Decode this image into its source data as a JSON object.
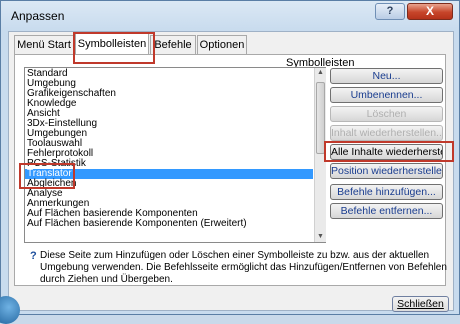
{
  "window": {
    "title": "Anpassen",
    "help_label": "?",
    "close_label": "X"
  },
  "tabs": [
    {
      "label": "Menü Start"
    },
    {
      "label": "Symbolleisten"
    },
    {
      "label": "Befehle"
    },
    {
      "label": "Optionen"
    }
  ],
  "list": {
    "header": "Symbolleisten",
    "items": [
      "Standard",
      "Umgebung",
      "Grafikeigenschaften",
      "Knowledge",
      "Ansicht",
      "3Dx-Einstellung",
      "Umgebungen",
      "Toolauswahl",
      "Fehlerprotokoll",
      "PCS-Statistik",
      "Translator",
      "Abgleichen",
      "Analyse",
      "Anmerkungen",
      "Auf Flächen basierende Komponenten",
      "Auf Flächen basierende Komponenten (Erweitert)"
    ],
    "selected": "Translator"
  },
  "buttons": {
    "new": "Neu...",
    "rename": "Umbenennen...",
    "delete": "Löschen",
    "restore_content": "Inhalt wiederherstellen...",
    "restore_all": "Alle Inhalte wiederherstellen...",
    "restore_position": "Position wiederherstellen",
    "add_commands": "Befehle hinzufügen...",
    "remove_commands": "Befehle entfernen..."
  },
  "info": {
    "icon": "question-icon",
    "text": "Diese Seite zum Hinzufügen oder Löschen einer Symbolleiste zu bzw. aus der aktuellen Umgebung verwenden. Die Befehlsseite ermöglicht das Hinzufügen/Entfernen von Befehlen durch Ziehen und Übergeben."
  },
  "footer": {
    "close": "Schließen"
  },
  "colors": {
    "selection": "#3399ff",
    "highlight": "#c0392b",
    "close_button": "#c7452a"
  }
}
